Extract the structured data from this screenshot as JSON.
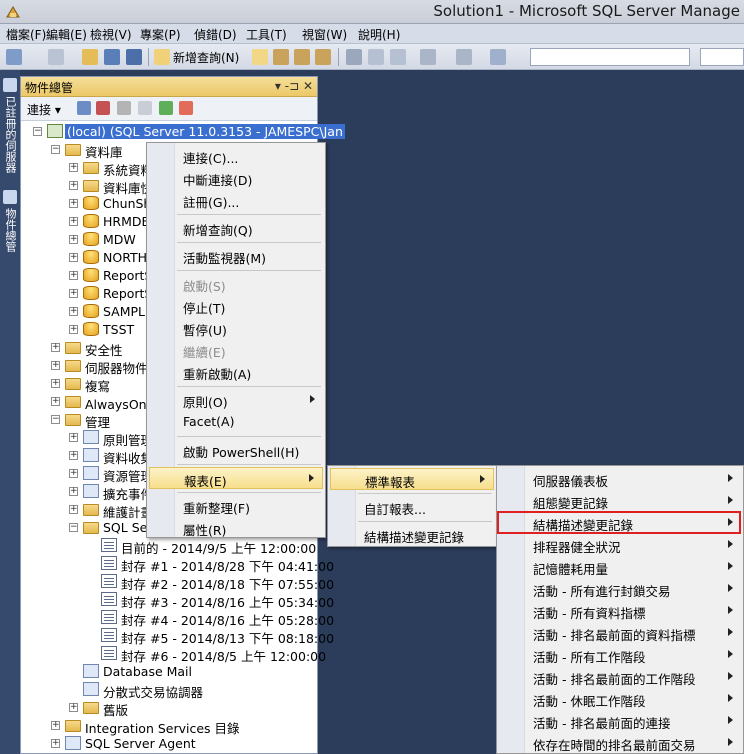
{
  "window": {
    "title": "Solution1 - Microsoft SQL Server Manage"
  },
  "menubar": [
    "檔案(F)",
    "編輯(E)",
    "檢視(V)",
    "專案(P)",
    "偵錯(D)",
    "工具(T)",
    "視窗(W)",
    "說明(H)"
  ],
  "toolbar": {
    "new_query": "新增查詢(N)"
  },
  "side_tabs": {
    "registered": "已註冊的伺服器",
    "explorer": "物件總管"
  },
  "explorer": {
    "title": "物件總管",
    "pin": "▾ ‑⊐ ✕",
    "connect": "連接 ▾",
    "root": "(local) (SQL Server 11.0.3153 - JAMESPC\\Jan",
    "nodes": [
      {
        "label": "資料庫",
        "indent": 1,
        "exp": "−",
        "icon": "folder"
      },
      {
        "label": "系統資料",
        "indent": 2,
        "exp": "+",
        "icon": "folder"
      },
      {
        "label": "資料庫快",
        "indent": 2,
        "exp": "+",
        "icon": "folder"
      },
      {
        "label": "ChunSh",
        "indent": 2,
        "exp": "+",
        "icon": "db"
      },
      {
        "label": "HRMDE",
        "indent": 2,
        "exp": "+",
        "icon": "db"
      },
      {
        "label": "MDW",
        "indent": 2,
        "exp": "+",
        "icon": "db"
      },
      {
        "label": "NORTH",
        "indent": 2,
        "exp": "+",
        "icon": "db"
      },
      {
        "label": "ReportS",
        "indent": 2,
        "exp": "+",
        "icon": "db"
      },
      {
        "label": "ReportS",
        "indent": 2,
        "exp": "+",
        "icon": "db"
      },
      {
        "label": "SAMPLI",
        "indent": 2,
        "exp": "+",
        "icon": "db"
      },
      {
        "label": "TSST",
        "indent": 2,
        "exp": "+",
        "icon": "db"
      },
      {
        "label": "安全性",
        "indent": 1,
        "exp": "+",
        "icon": "folder"
      },
      {
        "label": "伺服器物件",
        "indent": 1,
        "exp": "+",
        "icon": "folder"
      },
      {
        "label": "複寫",
        "indent": 1,
        "exp": "+",
        "icon": "folder"
      },
      {
        "label": "AlwaysOn 高",
        "indent": 1,
        "exp": "+",
        "icon": "folder"
      },
      {
        "label": "管理",
        "indent": 1,
        "exp": "−",
        "icon": "folder"
      },
      {
        "label": "原則管理",
        "indent": 2,
        "exp": "+",
        "icon": "gen"
      },
      {
        "label": "資料收集",
        "indent": 2,
        "exp": "+",
        "icon": "gen"
      },
      {
        "label": "資源管理",
        "indent": 2,
        "exp": "+",
        "icon": "gen"
      },
      {
        "label": "擴充事件",
        "indent": 2,
        "exp": "+",
        "icon": "gen"
      },
      {
        "label": "維護計畫",
        "indent": 2,
        "exp": "+",
        "icon": "folder"
      },
      {
        "label": "SQL Ser",
        "indent": 2,
        "exp": "−",
        "icon": "folder"
      },
      {
        "label": "目前的 - 2014/9/5 上午 12:00:00",
        "indent": 3,
        "exp": "",
        "icon": "sql"
      },
      {
        "label": "封存 #1 - 2014/8/28 下午 04:41:00",
        "indent": 3,
        "exp": "",
        "icon": "sql"
      },
      {
        "label": "封存 #2 - 2014/8/18 下午 07:55:00",
        "indent": 3,
        "exp": "",
        "icon": "sql"
      },
      {
        "label": "封存 #3 - 2014/8/16 上午 05:34:00",
        "indent": 3,
        "exp": "",
        "icon": "sql"
      },
      {
        "label": "封存 #4 - 2014/8/16 上午 05:28:00",
        "indent": 3,
        "exp": "",
        "icon": "sql"
      },
      {
        "label": "封存 #5 - 2014/8/13 下午 08:18:00",
        "indent": 3,
        "exp": "",
        "icon": "sql"
      },
      {
        "label": "封存 #6 - 2014/8/5 上午 12:00:00",
        "indent": 3,
        "exp": "",
        "icon": "sql"
      },
      {
        "label": "Database Mail",
        "indent": 2,
        "exp": "",
        "icon": "gen"
      },
      {
        "label": "分散式交易協調器",
        "indent": 2,
        "exp": "",
        "icon": "gen"
      },
      {
        "label": "舊版",
        "indent": 2,
        "exp": "+",
        "icon": "folder"
      },
      {
        "label": "Integration Services 目錄",
        "indent": 1,
        "exp": "+",
        "icon": "folder"
      },
      {
        "label": "SQL Server Agent",
        "indent": 1,
        "exp": "+",
        "icon": "gen"
      }
    ]
  },
  "context_menu": [
    {
      "label": "連接(C)..."
    },
    {
      "label": "中斷連接(D)"
    },
    {
      "label": "註冊(G)..."
    },
    {
      "sep": true
    },
    {
      "label": "新增查詢(Q)"
    },
    {
      "sep": true
    },
    {
      "label": "活動監視器(M)"
    },
    {
      "sep": true
    },
    {
      "label": "啟動(S)",
      "disabled": true
    },
    {
      "label": "停止(T)"
    },
    {
      "label": "暫停(U)"
    },
    {
      "label": "繼續(E)",
      "disabled": true
    },
    {
      "label": "重新啟動(A)"
    },
    {
      "sep": true
    },
    {
      "label": "原則(O)",
      "sub": true
    },
    {
      "label": "Facet(A)"
    },
    {
      "sep": true
    },
    {
      "label": "啟動 PowerShell(H)"
    },
    {
      "sep": true
    },
    {
      "label": "報表(E)",
      "sub": true,
      "hl": true
    },
    {
      "sep": true
    },
    {
      "label": "重新整理(F)"
    },
    {
      "label": "屬性(R)"
    }
  ],
  "reports_menu": [
    {
      "label": "標準報表",
      "sub": true,
      "hl": true
    },
    {
      "sep": true
    },
    {
      "label": "自訂報表..."
    },
    {
      "sep": true
    },
    {
      "label": "結構描述變更記錄"
    }
  ],
  "standard_reports": [
    "伺服器儀表板",
    "組態變更記錄",
    "結構描述變更記錄",
    "排程器健全狀況",
    "記憶體耗用量",
    "活動 - 所有進行封鎖交易",
    "活動 - 所有資料指標",
    "活動 - 排名最前面的資料指標",
    "活動 - 所有工作階段",
    "活動 - 排名最前面的工作階段",
    "活動 - 休眠工作階段",
    "活動 - 排名最前面的連接",
    "依存在時間的排名最前面交易"
  ],
  "highlighted_report": "結構描述變更記錄"
}
